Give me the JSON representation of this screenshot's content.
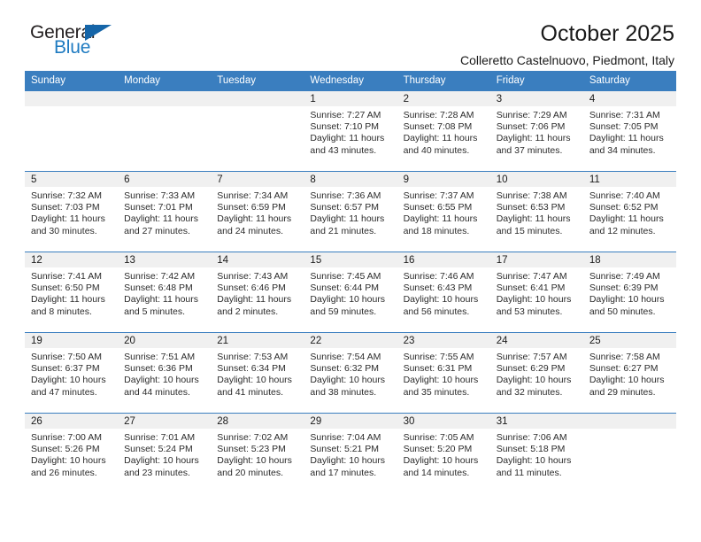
{
  "brand": {
    "logo_top": "General",
    "logo_bottom": "Blue",
    "triangle_color": "#1565a8",
    "blue_text_color": "#1f7bc1"
  },
  "header": {
    "title": "October 2025",
    "subtitle": "Colleretto Castelnuovo, Piedmont, Italy"
  },
  "theme": {
    "header_blue": "#3a7ebf",
    "date_band_gray": "#f0f0f0",
    "text_color": "#2b2b2b"
  },
  "weekday_headers": [
    "Sunday",
    "Monday",
    "Tuesday",
    "Wednesday",
    "Thursday",
    "Friday",
    "Saturday"
  ],
  "labels": {
    "sunrise_prefix": "Sunrise:",
    "sunset_prefix": "Sunset:",
    "daylight_prefix": "Daylight:"
  },
  "weeks": [
    [
      {
        "empty": true
      },
      {
        "empty": true
      },
      {
        "empty": true
      },
      {
        "date": "1",
        "sunrise": "Sunrise: 7:27 AM",
        "sunset": "Sunset: 7:10 PM",
        "daylight": "Daylight: 11 hours and 43 minutes."
      },
      {
        "date": "2",
        "sunrise": "Sunrise: 7:28 AM",
        "sunset": "Sunset: 7:08 PM",
        "daylight": "Daylight: 11 hours and 40 minutes."
      },
      {
        "date": "3",
        "sunrise": "Sunrise: 7:29 AM",
        "sunset": "Sunset: 7:06 PM",
        "daylight": "Daylight: 11 hours and 37 minutes."
      },
      {
        "date": "4",
        "sunrise": "Sunrise: 7:31 AM",
        "sunset": "Sunset: 7:05 PM",
        "daylight": "Daylight: 11 hours and 34 minutes."
      }
    ],
    [
      {
        "date": "5",
        "sunrise": "Sunrise: 7:32 AM",
        "sunset": "Sunset: 7:03 PM",
        "daylight": "Daylight: 11 hours and 30 minutes."
      },
      {
        "date": "6",
        "sunrise": "Sunrise: 7:33 AM",
        "sunset": "Sunset: 7:01 PM",
        "daylight": "Daylight: 11 hours and 27 minutes."
      },
      {
        "date": "7",
        "sunrise": "Sunrise: 7:34 AM",
        "sunset": "Sunset: 6:59 PM",
        "daylight": "Daylight: 11 hours and 24 minutes."
      },
      {
        "date": "8",
        "sunrise": "Sunrise: 7:36 AM",
        "sunset": "Sunset: 6:57 PM",
        "daylight": "Daylight: 11 hours and 21 minutes."
      },
      {
        "date": "9",
        "sunrise": "Sunrise: 7:37 AM",
        "sunset": "Sunset: 6:55 PM",
        "daylight": "Daylight: 11 hours and 18 minutes."
      },
      {
        "date": "10",
        "sunrise": "Sunrise: 7:38 AM",
        "sunset": "Sunset: 6:53 PM",
        "daylight": "Daylight: 11 hours and 15 minutes."
      },
      {
        "date": "11",
        "sunrise": "Sunrise: 7:40 AM",
        "sunset": "Sunset: 6:52 PM",
        "daylight": "Daylight: 11 hours and 12 minutes."
      }
    ],
    [
      {
        "date": "12",
        "sunrise": "Sunrise: 7:41 AM",
        "sunset": "Sunset: 6:50 PM",
        "daylight": "Daylight: 11 hours and 8 minutes."
      },
      {
        "date": "13",
        "sunrise": "Sunrise: 7:42 AM",
        "sunset": "Sunset: 6:48 PM",
        "daylight": "Daylight: 11 hours and 5 minutes."
      },
      {
        "date": "14",
        "sunrise": "Sunrise: 7:43 AM",
        "sunset": "Sunset: 6:46 PM",
        "daylight": "Daylight: 11 hours and 2 minutes."
      },
      {
        "date": "15",
        "sunrise": "Sunrise: 7:45 AM",
        "sunset": "Sunset: 6:44 PM",
        "daylight": "Daylight: 10 hours and 59 minutes."
      },
      {
        "date": "16",
        "sunrise": "Sunrise: 7:46 AM",
        "sunset": "Sunset: 6:43 PM",
        "daylight": "Daylight: 10 hours and 56 minutes."
      },
      {
        "date": "17",
        "sunrise": "Sunrise: 7:47 AM",
        "sunset": "Sunset: 6:41 PM",
        "daylight": "Daylight: 10 hours and 53 minutes."
      },
      {
        "date": "18",
        "sunrise": "Sunrise: 7:49 AM",
        "sunset": "Sunset: 6:39 PM",
        "daylight": "Daylight: 10 hours and 50 minutes."
      }
    ],
    [
      {
        "date": "19",
        "sunrise": "Sunrise: 7:50 AM",
        "sunset": "Sunset: 6:37 PM",
        "daylight": "Daylight: 10 hours and 47 minutes."
      },
      {
        "date": "20",
        "sunrise": "Sunrise: 7:51 AM",
        "sunset": "Sunset: 6:36 PM",
        "daylight": "Daylight: 10 hours and 44 minutes."
      },
      {
        "date": "21",
        "sunrise": "Sunrise: 7:53 AM",
        "sunset": "Sunset: 6:34 PM",
        "daylight": "Daylight: 10 hours and 41 minutes."
      },
      {
        "date": "22",
        "sunrise": "Sunrise: 7:54 AM",
        "sunset": "Sunset: 6:32 PM",
        "daylight": "Daylight: 10 hours and 38 minutes."
      },
      {
        "date": "23",
        "sunrise": "Sunrise: 7:55 AM",
        "sunset": "Sunset: 6:31 PM",
        "daylight": "Daylight: 10 hours and 35 minutes."
      },
      {
        "date": "24",
        "sunrise": "Sunrise: 7:57 AM",
        "sunset": "Sunset: 6:29 PM",
        "daylight": "Daylight: 10 hours and 32 minutes."
      },
      {
        "date": "25",
        "sunrise": "Sunrise: 7:58 AM",
        "sunset": "Sunset: 6:27 PM",
        "daylight": "Daylight: 10 hours and 29 minutes."
      }
    ],
    [
      {
        "date": "26",
        "sunrise": "Sunrise: 7:00 AM",
        "sunset": "Sunset: 5:26 PM",
        "daylight": "Daylight: 10 hours and 26 minutes."
      },
      {
        "date": "27",
        "sunrise": "Sunrise: 7:01 AM",
        "sunset": "Sunset: 5:24 PM",
        "daylight": "Daylight: 10 hours and 23 minutes."
      },
      {
        "date": "28",
        "sunrise": "Sunrise: 7:02 AM",
        "sunset": "Sunset: 5:23 PM",
        "daylight": "Daylight: 10 hours and 20 minutes."
      },
      {
        "date": "29",
        "sunrise": "Sunrise: 7:04 AM",
        "sunset": "Sunset: 5:21 PM",
        "daylight": "Daylight: 10 hours and 17 minutes."
      },
      {
        "date": "30",
        "sunrise": "Sunrise: 7:05 AM",
        "sunset": "Sunset: 5:20 PM",
        "daylight": "Daylight: 10 hours and 14 minutes."
      },
      {
        "date": "31",
        "sunrise": "Sunrise: 7:06 AM",
        "sunset": "Sunset: 5:18 PM",
        "daylight": "Daylight: 10 hours and 11 minutes."
      },
      {
        "empty": true
      }
    ]
  ]
}
